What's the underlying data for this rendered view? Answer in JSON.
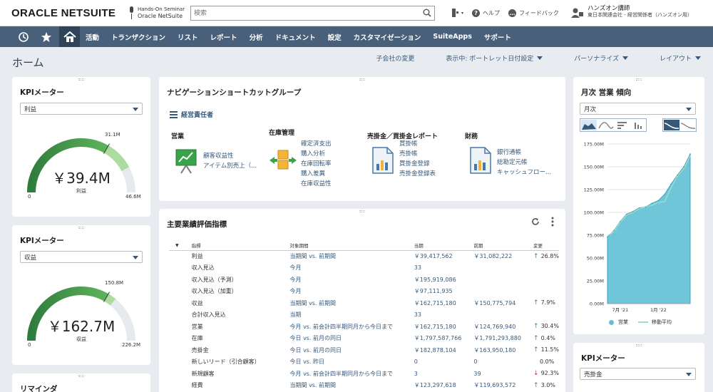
{
  "header": {
    "logo_oracle": "ORACLE",
    "logo_netsuite": "NETSUITE",
    "seminar_line1": "Hands-On Seminar",
    "seminar_line2": "Oracle NetSuite",
    "search_placeholder": "検索",
    "help_label": "ヘルプ",
    "feedback_label": "フィードバック",
    "user_name": "ハンズオン講師",
    "user_role": "東日本関連会社 - 経営関係者（ハンズオン用）"
  },
  "nav": {
    "items": [
      "活動",
      "トランザクション",
      "リスト",
      "レポート",
      "分析",
      "ドキュメント",
      "設定",
      "カスタマイゼーション",
      "SuiteApps",
      "サポート"
    ]
  },
  "page": {
    "title": "ホーム",
    "menu": [
      "子会社の変更",
      "表示中: ポートレット日付設定",
      "パーソナライズ",
      "レイアウト"
    ]
  },
  "kpi_meter_1": {
    "title": "KPIメーター",
    "select": "利益",
    "value": "￥39.4M",
    "label": "利益",
    "min": "0",
    "max": "46.6M",
    "target": "31.1M",
    "fill_fraction": 0.845,
    "target_fraction": 0.667
  },
  "kpi_meter_2": {
    "title": "KPIメーター",
    "select": "収益",
    "value": "￥162.7M",
    "label": "収益",
    "min": "0",
    "max": "226.2M",
    "target": "150.8M",
    "fill_fraction": 0.719,
    "target_fraction": 0.667
  },
  "reminders": {
    "title": "リマインダ"
  },
  "nav_shortcuts": {
    "title": "ナビゲーションショートカットグループ",
    "role": "経営責任者",
    "groups": [
      {
        "title": "営業",
        "icon": "presentation-chart-icon",
        "links": [
          "顧客収益性",
          "アイテム別売上（..."
        ]
      },
      {
        "title": "在庫管理",
        "icon": "inventory-boxes-icon",
        "links": [
          "確定済支出",
          "購入分析",
          "在庫回転率",
          "購入差異",
          "在庫収益性"
        ]
      },
      {
        "title": "売掛金／買掛金レポート",
        "icon": "report-document-icon",
        "links": [
          "買掛帳",
          "売掛帳",
          "買掛金登録",
          "売掛金登録表"
        ]
      },
      {
        "title": "財務",
        "icon": "report-document-icon",
        "links": [
          "銀行通帳",
          "総勘定元帳",
          "キャッシュフロー..."
        ]
      }
    ]
  },
  "kpi_table": {
    "title": "主要業績評価指標",
    "columns": [
      "指標",
      "対象期間",
      "当期",
      "前期",
      "変更"
    ],
    "rows": [
      {
        "metric": "利益",
        "period": "当期間 vs. 前期間",
        "current": "￥39,417,562",
        "previous": "￥31,082,222",
        "change": "26.8%",
        "dir": "up"
      },
      {
        "metric": "収入見込",
        "period": "今月",
        "current": "33",
        "previous": "",
        "change": "",
        "dir": ""
      },
      {
        "metric": "収入見込（予測）",
        "period": "今月",
        "current": "￥195,919,086",
        "previous": "",
        "change": "",
        "dir": ""
      },
      {
        "metric": "収入見込（加重）",
        "period": "今月",
        "current": "￥97,111,935",
        "previous": "",
        "change": "",
        "dir": ""
      },
      {
        "metric": "収益",
        "period": "当期間 vs. 前期間",
        "current": "￥162,715,180",
        "previous": "￥150,775,794",
        "change": "7.9%",
        "dir": "up"
      },
      {
        "metric": "合計収入見込",
        "period": "当期",
        "current": "33",
        "previous": "",
        "change": "",
        "dir": ""
      },
      {
        "metric": "営業",
        "period": "今月 vs. 前会計四半期同月から今日まで",
        "current": "￥162,715,180",
        "previous": "￥124,769,940",
        "change": "30.4%",
        "dir": "up"
      },
      {
        "metric": "在庫",
        "period": "今日 vs. 前月の同日",
        "current": "￥1,797,587,766",
        "previous": "￥1,791,293,880",
        "change": "0.4%",
        "dir": "up"
      },
      {
        "metric": "売掛金",
        "period": "今日 vs. 前月の同日",
        "current": "￥182,878,104",
        "previous": "￥163,950,180",
        "change": "11.5%",
        "dir": "up"
      },
      {
        "metric": "新しいリード（引合顧客）",
        "period": "今日 vs. 昨日",
        "current": "0",
        "previous": "0",
        "change": "0.0%",
        "dir": ""
      },
      {
        "metric": "新規顧客",
        "period": "今月 vs. 前会計四半期同月から今日まで",
        "current": "3",
        "previous": "39",
        "change": "92.3%",
        "dir": "down"
      },
      {
        "metric": "経費",
        "period": "当期間 vs. 前期間",
        "current": "￥123,297,618",
        "previous": "￥119,693,572",
        "change": "3.0%",
        "dir": "up"
      }
    ]
  },
  "trend": {
    "title": "月次 営業 傾向",
    "select": "月次",
    "legend": [
      "営業",
      "移動平均"
    ]
  },
  "kpi_meter_3": {
    "title": "KPIメーター",
    "select": "売掛金"
  },
  "colors": {
    "nav_bg": "#49607a",
    "link": "#36597a",
    "gauge_fill": "#3f9a4a",
    "area_fill": "#5ec0d4",
    "up": "#2e9a3a",
    "down": "#c0392b"
  },
  "chart_data": {
    "type": "area",
    "title": "月次 営業 傾向",
    "ylim": [
      0,
      175
    ],
    "yticks": [
      "0.00M",
      "25.00M",
      "50.00M",
      "75.00M",
      "100.00M",
      "125.00M",
      "150.00M",
      "175.00M"
    ],
    "xticks": [
      "7月 '21",
      "1月 '22"
    ],
    "x": [
      "2021-05",
      "2021-06",
      "2021-07",
      "2021-08",
      "2021-09",
      "2021-10",
      "2021-11",
      "2021-12",
      "2022-01",
      "2022-02",
      "2022-03",
      "2022-04",
      "2022-05",
      "2022-06"
    ],
    "series": [
      {
        "name": "営業",
        "values": [
          73,
          80,
          90,
          98,
          101,
          105,
          106,
          110,
          113,
          120,
          131,
          141,
          150,
          164
        ]
      },
      {
        "name": "移動平均",
        "values": [
          74,
          79,
          89,
          97,
          100,
          104,
          106,
          108,
          111,
          112,
          127,
          140,
          148,
          162
        ]
      }
    ]
  }
}
